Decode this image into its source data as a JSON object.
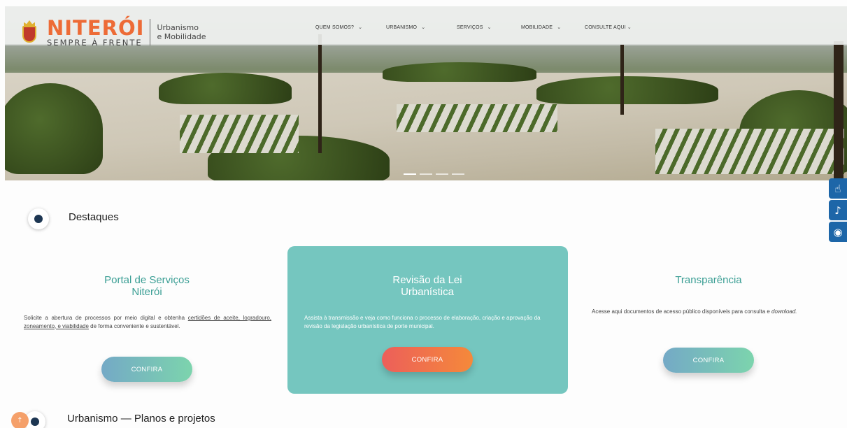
{
  "logo": {
    "name": "NITERÓI",
    "tagline": "SEMPRE À FRENTE",
    "sub_line1": "Urbanismo",
    "sub_line2": "e Mobilidade"
  },
  "nav": {
    "items": [
      {
        "label": "QUEM SOMOS?"
      },
      {
        "label": "URBANISMO"
      },
      {
        "label": "SERVIÇOS"
      },
      {
        "label": "MOBILIDADE"
      },
      {
        "label": "CONSULTE AQUI"
      }
    ],
    "chevron": "⌄"
  },
  "sections": {
    "highlights_title": "Destaques",
    "plans_title": "Urbanismo — Planos e projetos"
  },
  "cards": [
    {
      "title_line1": "Portal de Serviços",
      "title_line2": "Niterói",
      "text_before": "Solicite a abertura de processos por meio digital e obtenha ",
      "text_link": "certidões de aceite, logradouro, zoneamento, e viabilidade",
      "text_after": " de forma conveniente e sustentável.",
      "button": "CONFIRA"
    },
    {
      "title_line1": "Revisão da Lei",
      "title_line2": "Urbanística",
      "text": "Assista à transmissão e veja como funciona o processo de elaboração, criação e aprovação da revisão da legislação urbanística de porte municipal.",
      "button": "CONFIRA"
    },
    {
      "title_line1": "Transparência",
      "text_before": "Acesse aqui documentos de acesso público disponíveis para consulta e ",
      "text_italic": "download.",
      "button": "CONFIRA"
    }
  ],
  "accessibility": {
    "buttons": [
      {
        "icon": "sign-language-icon",
        "glyph": "☝"
      },
      {
        "icon": "audio-description-icon",
        "glyph": "♪"
      },
      {
        "icon": "low-vision-icon",
        "glyph": "◉"
      }
    ]
  },
  "colors": {
    "brand_orange": "#ed6b36",
    "teal_title": "#3a9e94",
    "featured_bg": "#75c6bf",
    "a11y_blue": "#1d66a8"
  },
  "scroll_top": {
    "glyph": "↑"
  }
}
